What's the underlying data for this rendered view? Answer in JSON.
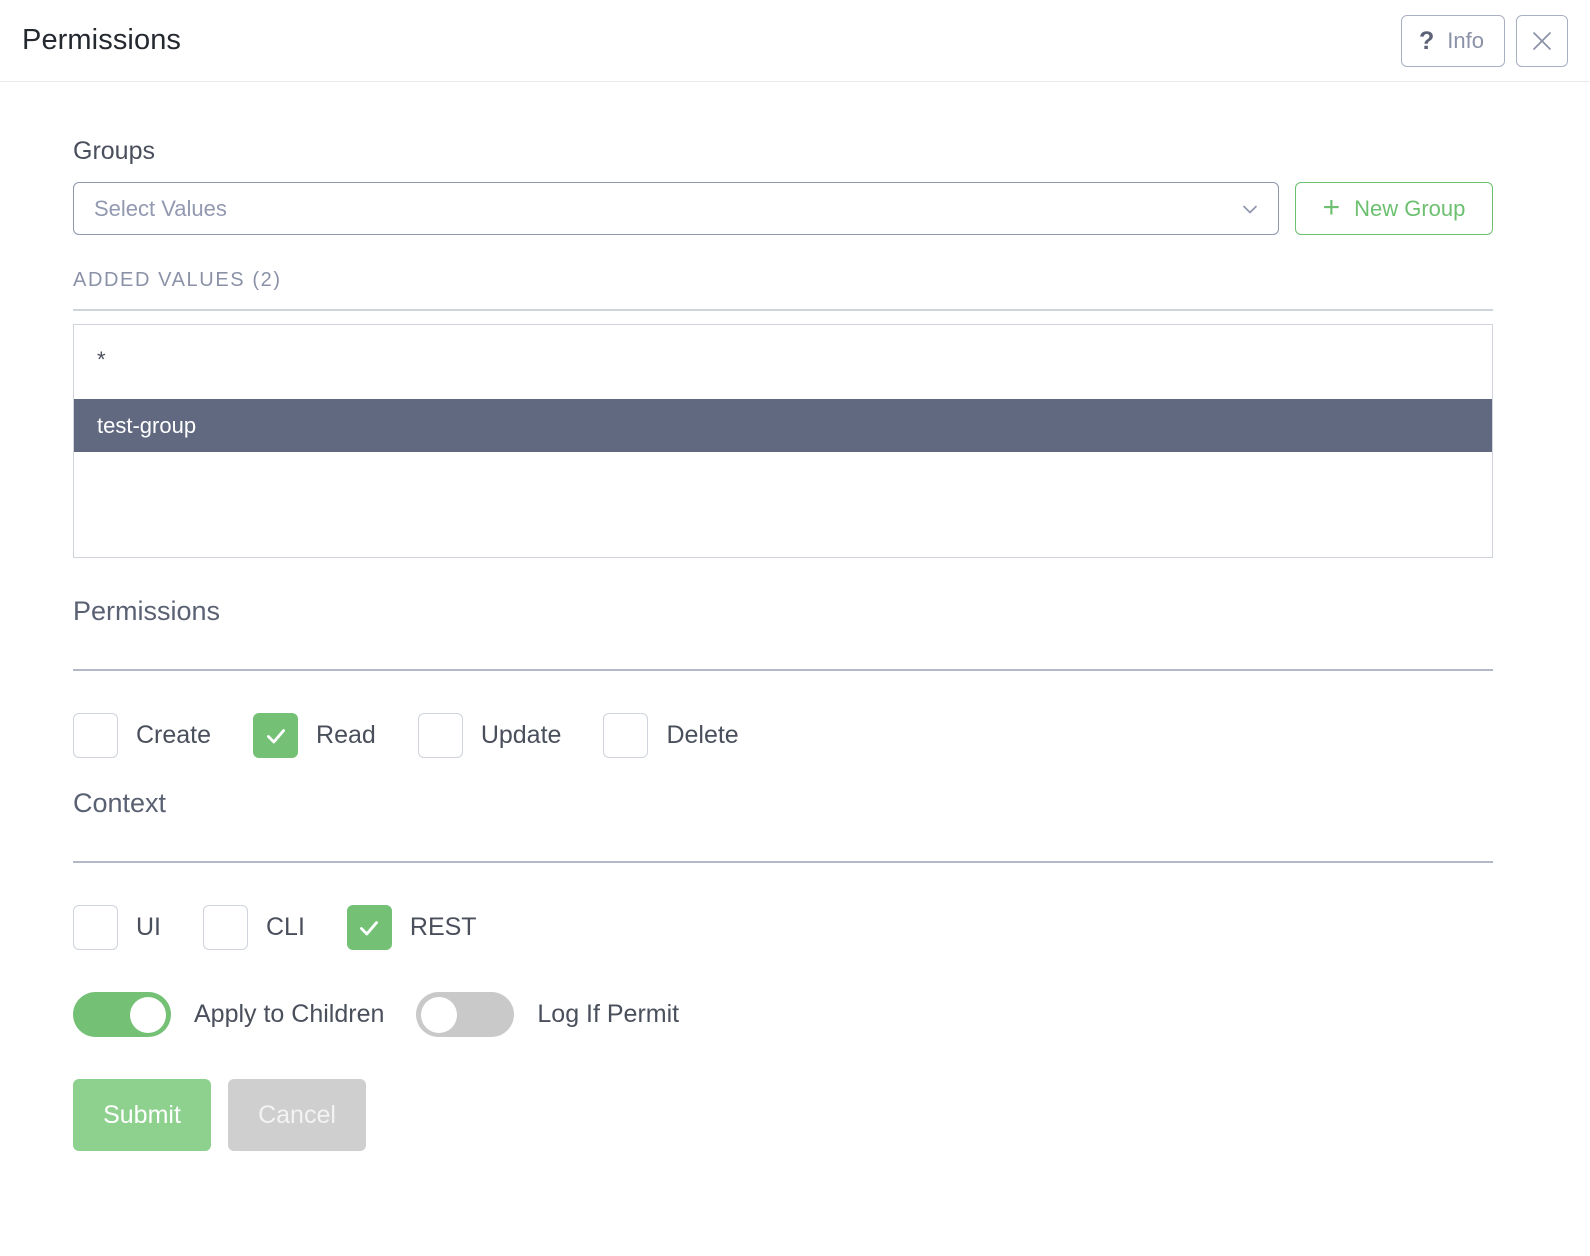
{
  "header": {
    "title": "Permissions",
    "info_label": "Info",
    "info_icon": "question-mark-icon",
    "close_icon": "close-x-icon"
  },
  "groups": {
    "label": "Groups",
    "select_placeholder": "Select Values",
    "select_value": "",
    "chevron_icon": "chevron-down-icon",
    "new_group_label": "New Group",
    "new_group_icon": "plus-icon",
    "added_values_label": "ADDED VALUES (2)",
    "items": [
      {
        "label": "*",
        "selected": false
      },
      {
        "label": "test-group",
        "selected": true
      }
    ]
  },
  "permissions": {
    "title": "Permissions",
    "checkboxes": [
      {
        "label": "Create",
        "checked": false
      },
      {
        "label": "Read",
        "checked": true
      },
      {
        "label": "Update",
        "checked": false
      },
      {
        "label": "Delete",
        "checked": false
      }
    ]
  },
  "context": {
    "title": "Context",
    "checkboxes": [
      {
        "label": "UI",
        "checked": false
      },
      {
        "label": "CLI",
        "checked": false
      },
      {
        "label": "REST",
        "checked": true
      }
    ],
    "toggles": [
      {
        "label": "Apply to Children",
        "on": true
      },
      {
        "label": "Log If Permit",
        "on": false
      }
    ]
  },
  "footer": {
    "submit_label": "Submit",
    "cancel_label": "Cancel"
  },
  "colors": {
    "accent_green": "#74c176",
    "submit_green": "#8ed18f",
    "selected_row": "#616981",
    "border_purple": "#8f96ae",
    "muted_text": "#8b92a8"
  }
}
